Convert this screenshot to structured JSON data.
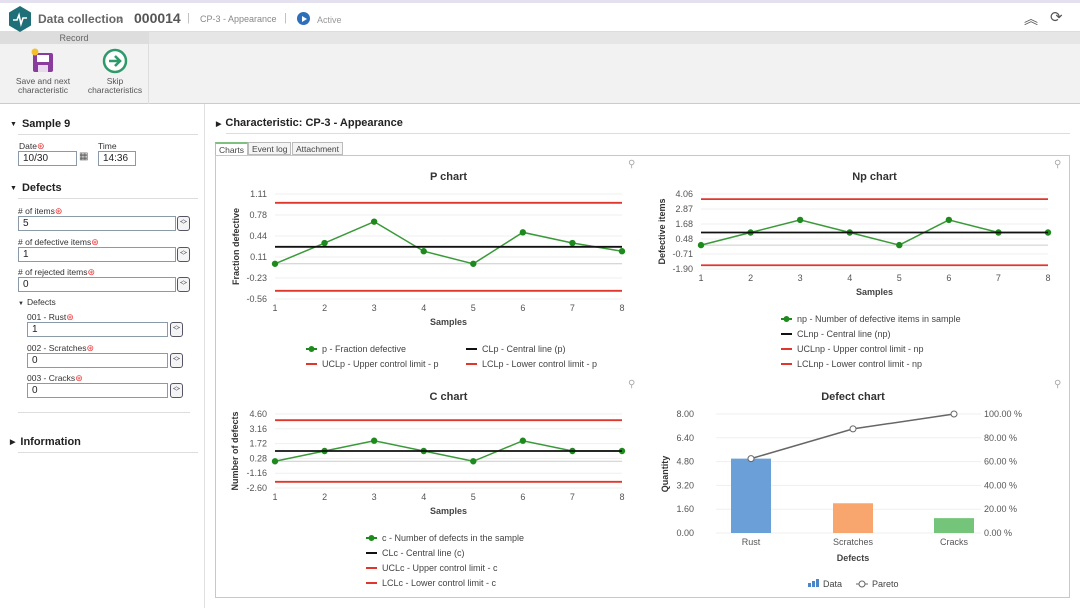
{
  "header": {
    "app": "Data collection",
    "record_id": "000014",
    "characteristic": "CP-3 - Appearance",
    "status": "Active",
    "icons": [
      "logo-pulse-icon",
      "chevron-right-icon",
      "play-icon",
      "collapse-up-icon",
      "refresh-icon"
    ]
  },
  "toolbar": {
    "group_label": "Record",
    "save_next_label": "Save and next characteristic",
    "skip_label": "Skip characteristics"
  },
  "sample": {
    "title": "Sample 9",
    "date_label": "Date",
    "date_value": "10/30",
    "time_label": "Time",
    "time_value": "14:36"
  },
  "defects_section": {
    "title": "Defects",
    "items_label": "# of items",
    "items_value": "5",
    "defective_label": "# of defective items",
    "defective_value": "1",
    "rejected_label": "# of rejected items",
    "rejected_value": "0",
    "sub_title": "Defects",
    "defects": [
      {
        "label": "001 - Rust",
        "value": "1"
      },
      {
        "label": "002 - Scratches",
        "value": "0"
      },
      {
        "label": "003 - Cracks",
        "value": "0"
      }
    ]
  },
  "information": {
    "title": "Information"
  },
  "main": {
    "title": "Characteristic: CP-3 - Appearance",
    "tabs": [
      "Charts",
      "Event log",
      "Attachment"
    ],
    "active_tab": "Charts"
  },
  "colors": {
    "point": "#1e8a1e",
    "central": "#111111",
    "limit": "#e0362c",
    "bar_rust": "#6a9fd8",
    "bar_scratches": "#f9a66e",
    "bar_cracks": "#74c47a",
    "pareto": "#666666"
  },
  "chart_data": [
    {
      "type": "line",
      "title": "P chart",
      "xlabel": "Samples",
      "ylabel": "Fraction defective",
      "x": [
        1,
        2,
        3,
        4,
        5,
        6,
        7,
        8
      ],
      "yticks": [
        "1.11",
        "0.78",
        "0.44",
        "0.11",
        "-0.23",
        "-0.56"
      ],
      "ylim": [
        -0.56,
        1.11
      ],
      "legend_columns": 2,
      "series": [
        {
          "name": "p - Fraction defective",
          "values": [
            0,
            0.33,
            0.67,
            0.2,
            0,
            0.5,
            0.33,
            0.2
          ],
          "role": "point"
        },
        {
          "name": "CLp - Central line (p)",
          "value": 0.27,
          "role": "central"
        },
        {
          "name": "UCLp - Upper control limit - p",
          "value": 0.97,
          "role": "limit"
        },
        {
          "name": "LCLp - Lower control limit - p",
          "value": -0.43,
          "role": "limit"
        }
      ]
    },
    {
      "type": "line",
      "title": "Np chart",
      "xlabel": "Samples",
      "ylabel": "Defective items",
      "x": [
        1,
        2,
        3,
        4,
        5,
        6,
        7,
        8
      ],
      "yticks": [
        "4.06",
        "2.87",
        "1.68",
        "0.48",
        "-0.71",
        "-1.90"
      ],
      "ylim": [
        -1.9,
        4.06
      ],
      "legend_columns": 1,
      "series": [
        {
          "name": "np - Number of defective items in sample",
          "values": [
            0,
            1,
            2,
            1,
            0,
            2,
            1,
            1
          ],
          "role": "point"
        },
        {
          "name": "CLnp - Central line (np)",
          "value": 1.0,
          "role": "central"
        },
        {
          "name": "UCLnp - Upper control limit - np",
          "value": 3.65,
          "role": "limit"
        },
        {
          "name": "LCLnp - Lower control limit - np",
          "value": -1.6,
          "role": "limit"
        }
      ]
    },
    {
      "type": "line",
      "title": "C chart",
      "xlabel": "Samples",
      "ylabel": "Number of defects",
      "x": [
        1,
        2,
        3,
        4,
        5,
        6,
        7,
        8
      ],
      "yticks": [
        "4.60",
        "3.16",
        "1.72",
        "0.28",
        "-1.16",
        "-2.60"
      ],
      "ylim": [
        -2.6,
        4.6
      ],
      "legend_columns": 1,
      "series": [
        {
          "name": "c - Number of defects in the sample",
          "values": [
            0,
            1,
            2,
            1,
            0,
            2,
            1,
            1
          ],
          "role": "point"
        },
        {
          "name": "CLc - Central line (c)",
          "value": 1.0,
          "role": "central"
        },
        {
          "name": "UCLc - Upper control limit - c",
          "value": 4.0,
          "role": "limit"
        },
        {
          "name": "LCLc - Lower control limit - c",
          "value": -2.0,
          "role": "limit"
        }
      ]
    },
    {
      "type": "bar",
      "title": "Defect chart",
      "xlabel": "Defects",
      "ylabel": "Quantity",
      "categories": [
        "Rust",
        "Scratches",
        "Cracks"
      ],
      "yticks": [
        "8.00",
        "6.40",
        "4.80",
        "3.20",
        "1.60",
        "0.00"
      ],
      "ylim": [
        0,
        8
      ],
      "y2ticks": [
        "100.00 %",
        "80.00 %",
        "60.00 %",
        "40.00 %",
        "20.00 %",
        "0.00 %"
      ],
      "y2lim": [
        0,
        100
      ],
      "series": [
        {
          "name": "Data",
          "values": [
            5,
            2,
            1
          ]
        },
        {
          "name": "Pareto",
          "values": [
            62.5,
            87.5,
            100
          ]
        }
      ]
    }
  ]
}
